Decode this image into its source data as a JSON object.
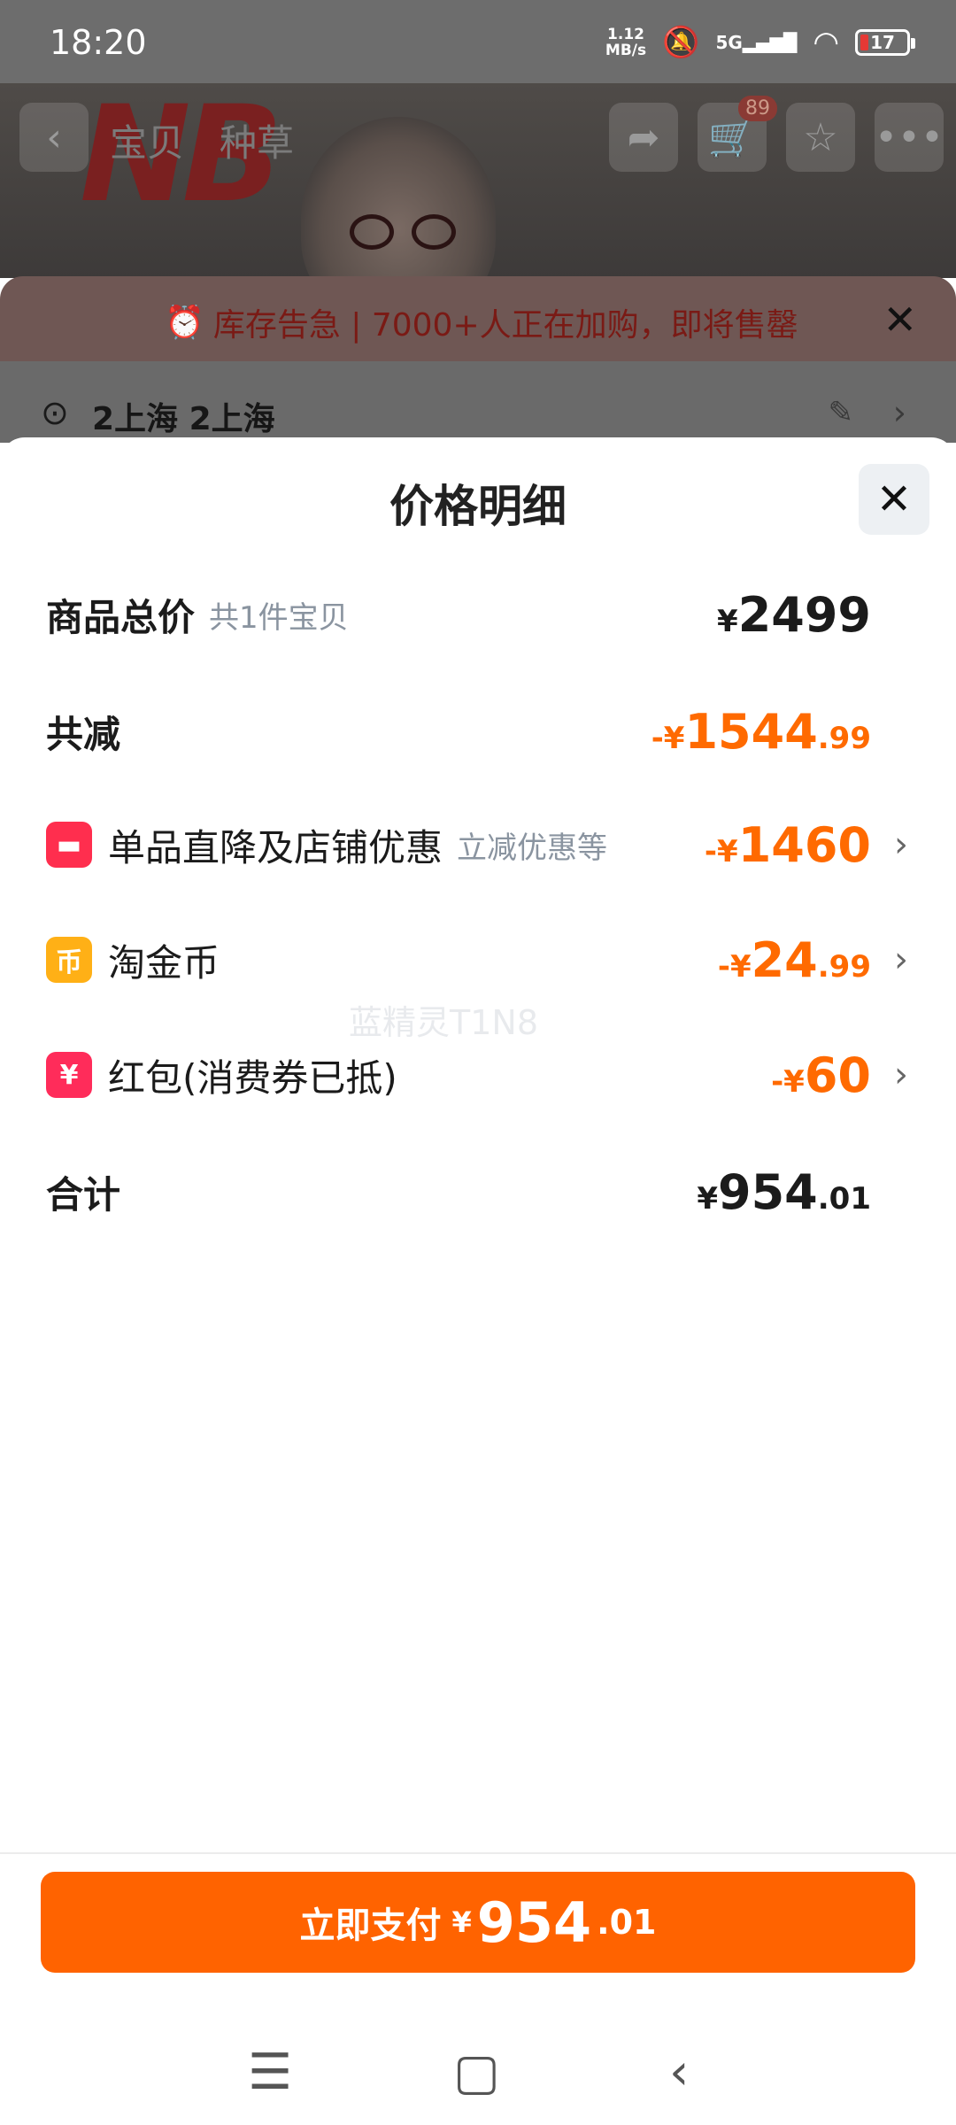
{
  "status_bar": {
    "time": "18:20",
    "net_speed_value": "1.12",
    "net_speed_unit": "MB/s",
    "signal_label": "5G",
    "battery": "17"
  },
  "background": {
    "tabs": [
      "宝贝",
      "种草"
    ],
    "cart_count": "89",
    "stock_alert": "库存告急 | 7000+人正在加购，即将售罄",
    "address": "2上海 2上海"
  },
  "sheet": {
    "title": "价格明细",
    "rows": {
      "total": {
        "label": "商品总价",
        "sub": "共1件宝贝",
        "yen": "¥",
        "int": "2499",
        "dec": ""
      },
      "reduction": {
        "label": "共减",
        "prefix": "-¥",
        "int": "1544",
        "dec": ".99"
      },
      "discount": {
        "label": "单品直降及店铺优惠",
        "sub": "立减优惠等",
        "prefix": "-¥",
        "int": "1460",
        "dec": "",
        "icon": "store-icon"
      },
      "coins": {
        "label": "淘金币",
        "prefix": "-¥",
        "int": "24",
        "dec": ".99",
        "icon": "coin-icon",
        "icon_glyph": "币"
      },
      "redpacket": {
        "label": "红包(消费券已抵)",
        "prefix": "-¥",
        "int": "60",
        "dec": "",
        "icon": "red-packet-icon",
        "icon_glyph": "¥"
      },
      "sum": {
        "label": "合计",
        "yen": "¥",
        "int": "954",
        "dec": ".01"
      }
    },
    "watermark": "蓝精灵T1N8"
  },
  "pay_button": {
    "label": "立即支付",
    "yen": "¥",
    "int": "954",
    "dec": ".01"
  },
  "colors": {
    "accent": "#ff6300",
    "discount_text": "#ff6a00"
  }
}
